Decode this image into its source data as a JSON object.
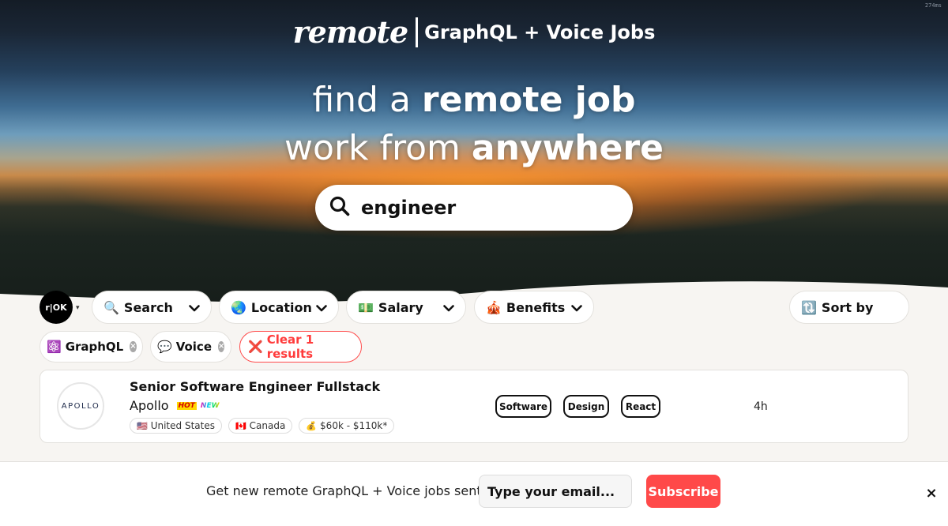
{
  "corner_text": "274ms",
  "brand": {
    "logo": "remote",
    "subtitle": "GraphQL + Voice Jobs"
  },
  "hero": {
    "line1_light": "find a ",
    "line1_bold": "remote job",
    "line2_light": "work from ",
    "line2_bold": "anywhere"
  },
  "search": {
    "value": "engineer",
    "icon": "search-icon"
  },
  "avatar": {
    "text": "r|OK"
  },
  "filters": {
    "search": {
      "emoji": "🔍",
      "label": "Search"
    },
    "location": {
      "emoji": "🌏",
      "label": "Location"
    },
    "salary": {
      "emoji": "💵",
      "label": "Salary"
    },
    "benefits": {
      "emoji": "🎪",
      "label": "Benefits"
    },
    "sort": {
      "emoji": "🔃",
      "label": "Sort by"
    }
  },
  "tags": {
    "graphql": {
      "emoji": "⚛️",
      "label": "GraphQL"
    },
    "voice": {
      "emoji": "💬",
      "label": "Voice"
    },
    "clear": {
      "emoji": "❌",
      "label": "Clear 1 results"
    }
  },
  "job": {
    "logo_text": "APOLLO",
    "title": "Senior Software Engineer Fullstack",
    "company": "Apollo",
    "badge_hot": "HOT",
    "badge_new": "NEW",
    "locations": [
      {
        "flag": "🇺🇸",
        "label": "United States"
      },
      {
        "flag": "🇨🇦",
        "label": "Canada"
      }
    ],
    "salary": {
      "emoji": "💰",
      "label": "$60k - $110k*"
    },
    "skills": [
      "Software",
      "Design",
      "React"
    ],
    "age": "4h"
  },
  "subscribe": {
    "text": "Get new remote GraphQL + Voice jobs sent to",
    "placeholder": "Type your email...",
    "button": "Subscribe",
    "close": "×"
  },
  "colors": {
    "accent_red": "#ff4949",
    "background": "#f7f5f2"
  }
}
